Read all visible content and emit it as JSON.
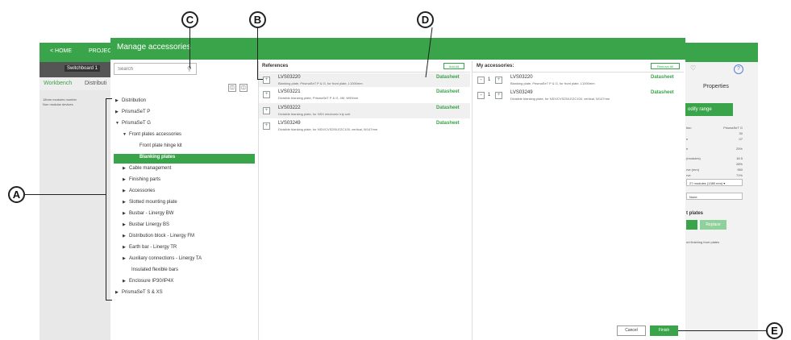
{
  "background_app": {
    "home_label": "HOME",
    "project_label": "PROJECT",
    "switchboard_label": "Switchboard 1",
    "tab_workbench": "Workbench",
    "tab_distribution": "Distributi",
    "info_line1": "18mm modules number",
    "info_line2": "Non modular devices",
    "properties_label": "Properties",
    "modify_range_label": "odify range",
    "right_rows": [
      {
        "label": "tion",
        "value": "PrismaSeT G"
      },
      {
        "label": "",
        "value": "30"
      },
      {
        "label": "e",
        "value": "07"
      },
      {
        "label": "e",
        "value": "25%"
      },
      {
        "label": "(modules)",
        "value": "18.5"
      },
      {
        "label": "",
        "value": "28%"
      },
      {
        "label": "rve (mm)",
        "value": "950"
      },
      {
        "label": "rve",
        "value": "71%"
      }
    ],
    "select1_value": "27 modules (1380 mm)",
    "select2_value": "None",
    "plates_label": "t plates",
    "replace_label": "Replace",
    "finishing_label": "ed finishing front plates"
  },
  "dialog": {
    "title": "Manage accessories",
    "search_placeholder": "Search",
    "tree": [
      {
        "label": "Distribution",
        "arrow": "▶",
        "level": 0
      },
      {
        "label": "PrismaSeT P",
        "arrow": "▶",
        "level": 0
      },
      {
        "label": "PrismaSeT G",
        "arrow": "▼",
        "level": 0
      },
      {
        "label": "Front plates accessories",
        "arrow": "▼",
        "level": 1
      },
      {
        "label": "Front plate hinge kit",
        "arrow": "",
        "level": 2
      },
      {
        "label": "Blanking plates",
        "arrow": "",
        "level": 2,
        "selected": true
      },
      {
        "label": "Cable management",
        "arrow": "▶",
        "level": 1
      },
      {
        "label": "Finishing parts",
        "arrow": "▶",
        "level": 1
      },
      {
        "label": "Accessories",
        "arrow": "▶",
        "level": 1
      },
      {
        "label": "Slotted mounting plate",
        "arrow": "▶",
        "level": 1
      },
      {
        "label": "Busbar - Linergy BW",
        "arrow": "▶",
        "level": 1
      },
      {
        "label": "Busbar Linergy BS",
        "arrow": "▶",
        "level": 1
      },
      {
        "label": "Distribution block - Linergy FM",
        "arrow": "▶",
        "level": 1
      },
      {
        "label": "Earth bar - Linergy TR",
        "arrow": "▶",
        "level": 1
      },
      {
        "label": "Auxiliary connections - Linergy TA",
        "arrow": "▶",
        "level": 1
      },
      {
        "label": "Insulated flexible bars",
        "arrow": "",
        "level": 1
      },
      {
        "label": "Enclosure IP30/IP4X",
        "arrow": "▶",
        "level": 1
      },
      {
        "label": "PrismaSeT S & XS",
        "arrow": "▶",
        "level": 0
      }
    ],
    "references_header": "References",
    "add_all_label": "Add All",
    "references": [
      {
        "code": "LVS03220",
        "desc": "Blanking plate, PrismaSeT P & G, for front plate, L1000mm",
        "datasheet": "Datasheet"
      },
      {
        "code": "LVS03221",
        "desc": "Divisible blanking plate, PrismaSeT P & G, 4M, W90mm",
        "datasheet": "Datasheet"
      },
      {
        "code": "LVS03222",
        "desc": "Divisible blanking plate, for NSX electronic trip unit",
        "datasheet": "Datasheet"
      },
      {
        "code": "LVS03249",
        "desc": "Divisible blanking plate, for NSX/CVS250-EZC100, vertical, W147mm",
        "datasheet": "Datasheet"
      }
    ],
    "my_accessories_header": "My accessories:",
    "remove_all_label": "Remove All",
    "my_accessories": [
      {
        "qty": "1",
        "code": "LVS03220",
        "desc": "Blanking plate, PrismaSeT P & G, for front plate, L1000mm",
        "datasheet": "Datasheet"
      },
      {
        "qty": "1",
        "code": "LVS03249",
        "desc": "Divisible blanking plate, for NSX/CVS250-EZC100, vertical, W147mm",
        "datasheet": "Datasheet"
      }
    ],
    "cancel_label": "Cancel",
    "finish_label": "Finish"
  },
  "callouts": {
    "a": "A",
    "b": "B",
    "c": "C",
    "d": "D",
    "e": "E"
  },
  "colors": {
    "accent": "#3aa44a"
  }
}
